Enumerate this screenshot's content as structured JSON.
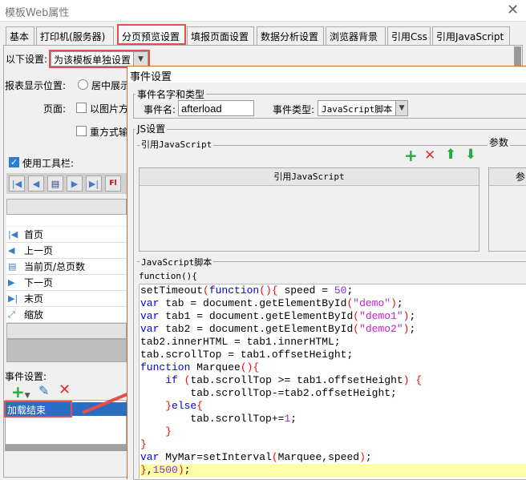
{
  "window": {
    "title": "模板Web属性",
    "close": "✕"
  },
  "tabs": [
    {
      "label": "基本"
    },
    {
      "label": "打印机(服务器)"
    },
    {
      "label": "分页预览设置"
    },
    {
      "label": "填报页面设置"
    },
    {
      "label": "数据分析设置"
    },
    {
      "label": "浏览器背景"
    },
    {
      "label": "引用Css"
    },
    {
      "label": "引用JavaScript"
    }
  ],
  "settings": {
    "label": "以下设置:",
    "value": "为该模板单独设置"
  },
  "left": {
    "position_label": "报表显示位置:",
    "position_option": "居中展示",
    "page_label": "页面:",
    "option_image": "以图片方",
    "option_reprint": "重方式输",
    "use_toolbar": "使用工具栏:",
    "toolbar_items": [
      {
        "label": "首页",
        "icon": "first-page-icon"
      },
      {
        "label": "上一页",
        "icon": "prev-page-icon"
      },
      {
        "label": "当前页/总页数",
        "icon": "page-count-icon"
      },
      {
        "label": "下一页",
        "icon": "next-page-icon"
      },
      {
        "label": "末页",
        "icon": "last-page-icon"
      },
      {
        "label": "缩放",
        "icon": "zoom-icon"
      }
    ],
    "event_label": "事件设置:",
    "event_item": "加载结束"
  },
  "dialog": {
    "title": "事件设置",
    "name_type_legend": "事件名字和类型",
    "event_name_label": "事件名:",
    "event_name_value": "afterload",
    "event_type_label": "事件类型:",
    "event_type_value": "JavaScript脚本",
    "js_legend": "JS设置",
    "ref_js_legend": "引用JavaScript",
    "params_legend": "参数",
    "ref_js_column": "引用JavaScript",
    "params_column": "参",
    "script_legend": "JavaScript脚本",
    "function_header": "function(){",
    "code": [
      [
        [
          "setTimeout",
          "p"
        ],
        [
          "(",
          "r"
        ],
        [
          "function",
          "k"
        ],
        [
          "(){",
          "r"
        ],
        [
          " speed = ",
          "p"
        ],
        [
          "50",
          "n"
        ],
        [
          ";",
          "p"
        ]
      ],
      [
        [
          "var",
          "k"
        ],
        [
          " tab = document.getElementById",
          "p"
        ],
        [
          "(",
          "r"
        ],
        [
          "\"demo\"",
          "s"
        ],
        [
          ")",
          "r"
        ],
        [
          ";",
          "p"
        ]
      ],
      [
        [
          "var",
          "k"
        ],
        [
          " tab1 = document.getElementById",
          "p"
        ],
        [
          "(",
          "r"
        ],
        [
          "\"demo1\"",
          "s"
        ],
        [
          ")",
          "r"
        ],
        [
          ";",
          "p"
        ]
      ],
      [
        [
          "var",
          "k"
        ],
        [
          " tab2 = document.getElementById",
          "p"
        ],
        [
          "(",
          "r"
        ],
        [
          "\"demo2\"",
          "s"
        ],
        [
          ")",
          "r"
        ],
        [
          ";",
          "p"
        ]
      ],
      [
        [
          "tab2.innerHTML = tab1.innerHTML;",
          "p"
        ]
      ],
      [
        [
          "tab.scrollTop = tab1.offsetHeight;",
          "p"
        ]
      ],
      [
        [
          "function",
          "k"
        ],
        [
          " Marquee",
          "p"
        ],
        [
          "(){",
          "r"
        ]
      ],
      [
        [
          "    ",
          "p"
        ],
        [
          "if",
          "k"
        ],
        [
          " ",
          "p"
        ],
        [
          "(",
          "r"
        ],
        [
          "tab.scrollTop >= tab1.offsetHeight",
          "p"
        ],
        [
          ")",
          "r"
        ],
        [
          " ",
          "p"
        ],
        [
          "{",
          "r"
        ]
      ],
      [
        [
          "        tab.scrollTop-=tab2.offsetHeight;",
          "p"
        ]
      ],
      [
        [
          "    ",
          "p"
        ],
        [
          "}",
          "r"
        ],
        [
          "else",
          "k"
        ],
        [
          "{",
          "r"
        ]
      ],
      [
        [
          "        tab.scrollTop+=",
          "p"
        ],
        [
          "1",
          "n"
        ],
        [
          ";",
          "p"
        ]
      ],
      [
        [
          "    ",
          "p"
        ],
        [
          "}",
          "r"
        ]
      ],
      [
        [
          "}",
          "r"
        ]
      ],
      [
        [
          "var",
          "k"
        ],
        [
          " MyMar=setInterval",
          "p"
        ],
        [
          "(",
          "r"
        ],
        [
          "Marquee,speed",
          "p"
        ],
        [
          ")",
          "r"
        ],
        [
          ";",
          "p"
        ]
      ],
      [
        [
          "}",
          "r"
        ],
        [
          ",",
          "p"
        ],
        [
          "1500",
          "n"
        ],
        [
          ")",
          "r"
        ],
        [
          ";",
          "p"
        ]
      ]
    ]
  },
  "colors": {
    "accent": "#2a6ebf",
    "highlight": "#e84c4c"
  }
}
